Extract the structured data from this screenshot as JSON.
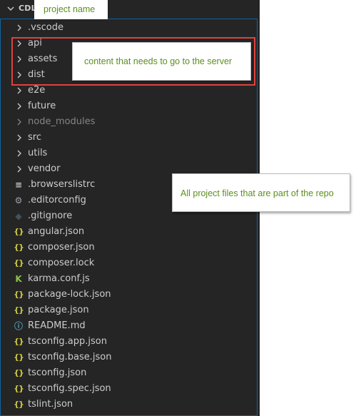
{
  "explorer": {
    "root_label": "CDL-",
    "items": [
      {
        "kind": "folder",
        "label": ".vscode",
        "dim": false
      },
      {
        "kind": "folder",
        "label": "api",
        "dim": false
      },
      {
        "kind": "folder",
        "label": "assets",
        "dim": false
      },
      {
        "kind": "folder",
        "label": "dist",
        "dim": false
      },
      {
        "kind": "folder",
        "label": "e2e",
        "dim": false
      },
      {
        "kind": "folder",
        "label": "future",
        "dim": false
      },
      {
        "kind": "folder",
        "label": "node_modules",
        "dim": true
      },
      {
        "kind": "folder",
        "label": "src",
        "dim": false
      },
      {
        "kind": "folder",
        "label": "utils",
        "dim": false
      },
      {
        "kind": "folder",
        "label": "vendor",
        "dim": false
      },
      {
        "kind": "file",
        "label": ".browserslistrc",
        "icon": "lines-icon",
        "glyph": "≡",
        "color": "#cccccc"
      },
      {
        "kind": "file",
        "label": ".editorconfig",
        "icon": "gear-icon",
        "glyph": "⚙",
        "color": "#9aa0a6"
      },
      {
        "kind": "file",
        "label": ".gitignore",
        "icon": "git-icon",
        "glyph": "◆",
        "color": "#41535b"
      },
      {
        "kind": "file",
        "label": "angular.json",
        "icon": "json-braces-icon",
        "glyph": "{}",
        "color": "#cbcb41"
      },
      {
        "kind": "file",
        "label": "composer.json",
        "icon": "json-braces-icon",
        "glyph": "{}",
        "color": "#cbcb41"
      },
      {
        "kind": "file",
        "label": "composer.lock",
        "icon": "json-braces-icon",
        "glyph": "{}",
        "color": "#cbcb41"
      },
      {
        "kind": "file",
        "label": "karma.conf.js",
        "icon": "karma-icon",
        "glyph": "K",
        "color": "#8dc149"
      },
      {
        "kind": "file",
        "label": "package-lock.json",
        "icon": "json-braces-icon",
        "glyph": "{}",
        "color": "#cbcb41"
      },
      {
        "kind": "file",
        "label": "package.json",
        "icon": "json-braces-icon",
        "glyph": "{}",
        "color": "#cbcb41"
      },
      {
        "kind": "file",
        "label": "README.md",
        "icon": "info-icon",
        "glyph": "ⓘ",
        "color": "#519aba"
      },
      {
        "kind": "file",
        "label": "tsconfig.app.json",
        "icon": "json-braces-icon",
        "glyph": "{}",
        "color": "#cbcb41"
      },
      {
        "kind": "file",
        "label": "tsconfig.base.json",
        "icon": "json-braces-icon",
        "glyph": "{}",
        "color": "#cbcb41"
      },
      {
        "kind": "file",
        "label": "tsconfig.json",
        "icon": "json-braces-icon",
        "glyph": "{}",
        "color": "#cbcb41"
      },
      {
        "kind": "file",
        "label": "tsconfig.spec.json",
        "icon": "json-braces-icon",
        "glyph": "{}",
        "color": "#cbcb41"
      },
      {
        "kind": "file",
        "label": "tslint.json",
        "icon": "json-braces-icon",
        "glyph": "{}",
        "color": "#cbcb41"
      }
    ]
  },
  "annotations": {
    "project_name": "project name",
    "server_content": "content that needs to go to the server",
    "repo_files": "All project files that are part of the repo"
  },
  "colors": {
    "sidebar_bg": "#252526",
    "highlight_border": "#e0413b",
    "callout_text": "#5a8f1c",
    "focus_border": "#0e639c"
  }
}
